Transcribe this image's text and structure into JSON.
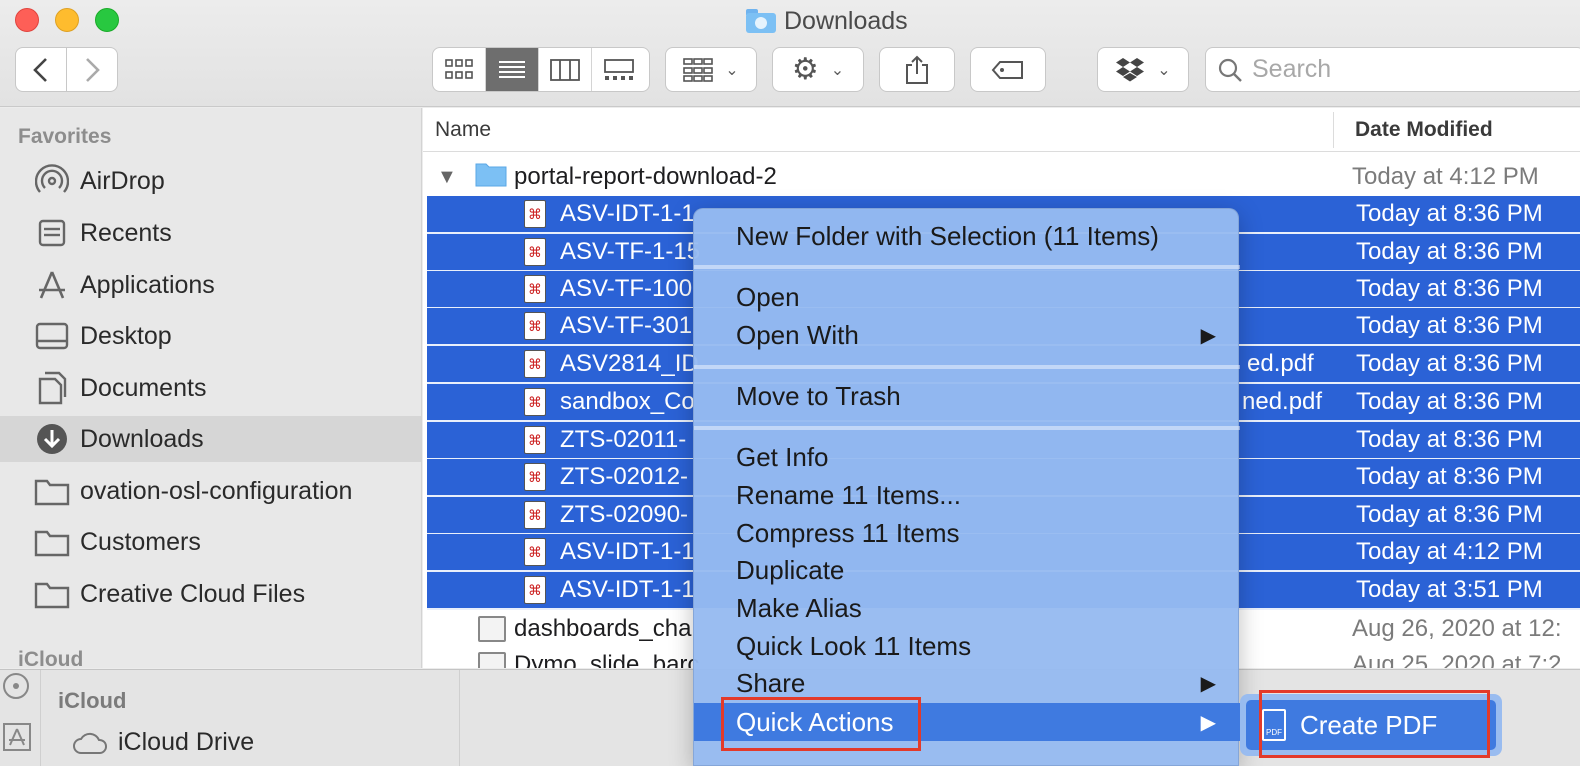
{
  "window": {
    "title": "Downloads"
  },
  "toolbar": {
    "view_modes": [
      "icon-view",
      "list-view",
      "column-view",
      "gallery-view"
    ],
    "active_view": "list-view",
    "search_placeholder": "Search"
  },
  "sidebar": {
    "favorites_heading": "Favorites",
    "items": [
      {
        "label": "AirDrop",
        "icon": "airdrop-icon"
      },
      {
        "label": "Recents",
        "icon": "recents-icon"
      },
      {
        "label": "Applications",
        "icon": "applications-icon"
      },
      {
        "label": "Desktop",
        "icon": "desktop-icon"
      },
      {
        "label": "Documents",
        "icon": "documents-icon"
      },
      {
        "label": "Downloads",
        "icon": "downloads-icon",
        "selected": true
      },
      {
        "label": "ovation-osl-configuration",
        "icon": "folder-icon"
      },
      {
        "label": "Customers",
        "icon": "folder-icon"
      },
      {
        "label": "Creative Cloud Files",
        "icon": "folder-icon"
      }
    ],
    "icloud_heading": "iCloud"
  },
  "columns": {
    "name": "Name",
    "date_modified": "Date Modified"
  },
  "folder_row": {
    "name": "portal-report-download-2",
    "date": "Today at 4:12 PM"
  },
  "selected_rows": [
    {
      "name": "ASV-IDT-1-1",
      "tail": "",
      "date": "Today at 8:36 PM"
    },
    {
      "name": "ASV-TF-1-15",
      "tail": "",
      "date": "Today at 8:36 PM"
    },
    {
      "name": "ASV-TF-100",
      "tail": "",
      "date": "Today at 8:36 PM"
    },
    {
      "name": "ASV-TF-301",
      "tail": "",
      "date": "Today at 8:36 PM"
    },
    {
      "name": "ASV2814_ID",
      "tail": "ed.pdf",
      "date": "Today at 8:36 PM"
    },
    {
      "name": "sandbox_Co",
      "tail": "ned.pdf",
      "date": "Today at 8:36 PM"
    },
    {
      "name": "ZTS-02011-",
      "tail": "",
      "date": "Today at 8:36 PM"
    },
    {
      "name": "ZTS-02012-",
      "tail": "",
      "date": "Today at 8:36 PM"
    },
    {
      "name": "ZTS-02090-",
      "tail": "",
      "date": "Today at 8:36 PM"
    },
    {
      "name": "ASV-IDT-1-1",
      "tail": "",
      "date": "Today at 4:12 PM"
    },
    {
      "name": "ASV-IDT-1-1",
      "tail": "",
      "date": "Today at 3:51 PM"
    }
  ],
  "other_rows": [
    {
      "name": "dashboards_cha",
      "date": "Aug 26, 2020 at 12:"
    },
    {
      "name": "Dymo_slide_barc",
      "date": "Aug 25, 2020 at 7:2"
    }
  ],
  "underlying_window": {
    "icloud_heading": "iCloud",
    "icloud_drive": "iCloud Drive"
  },
  "context_menu": {
    "new_folder": "New Folder with Selection (11 Items)",
    "open": "Open",
    "open_with": "Open With",
    "move_to_trash": "Move to Trash",
    "get_info": "Get Info",
    "rename": "Rename 11 Items...",
    "compress": "Compress 11 Items",
    "duplicate": "Duplicate",
    "make_alias": "Make Alias",
    "quick_look": "Quick Look 11 Items",
    "share": "Share",
    "quick_actions": "Quick Actions",
    "submenu_arrow": "▶"
  },
  "submenu": {
    "create_pdf": "Create PDF",
    "pdf_icon_text": "PDF"
  },
  "colors": {
    "selection": "#2b62d6",
    "menu_highlight": "#3f7ae0",
    "annotation": "#e33a2a"
  }
}
